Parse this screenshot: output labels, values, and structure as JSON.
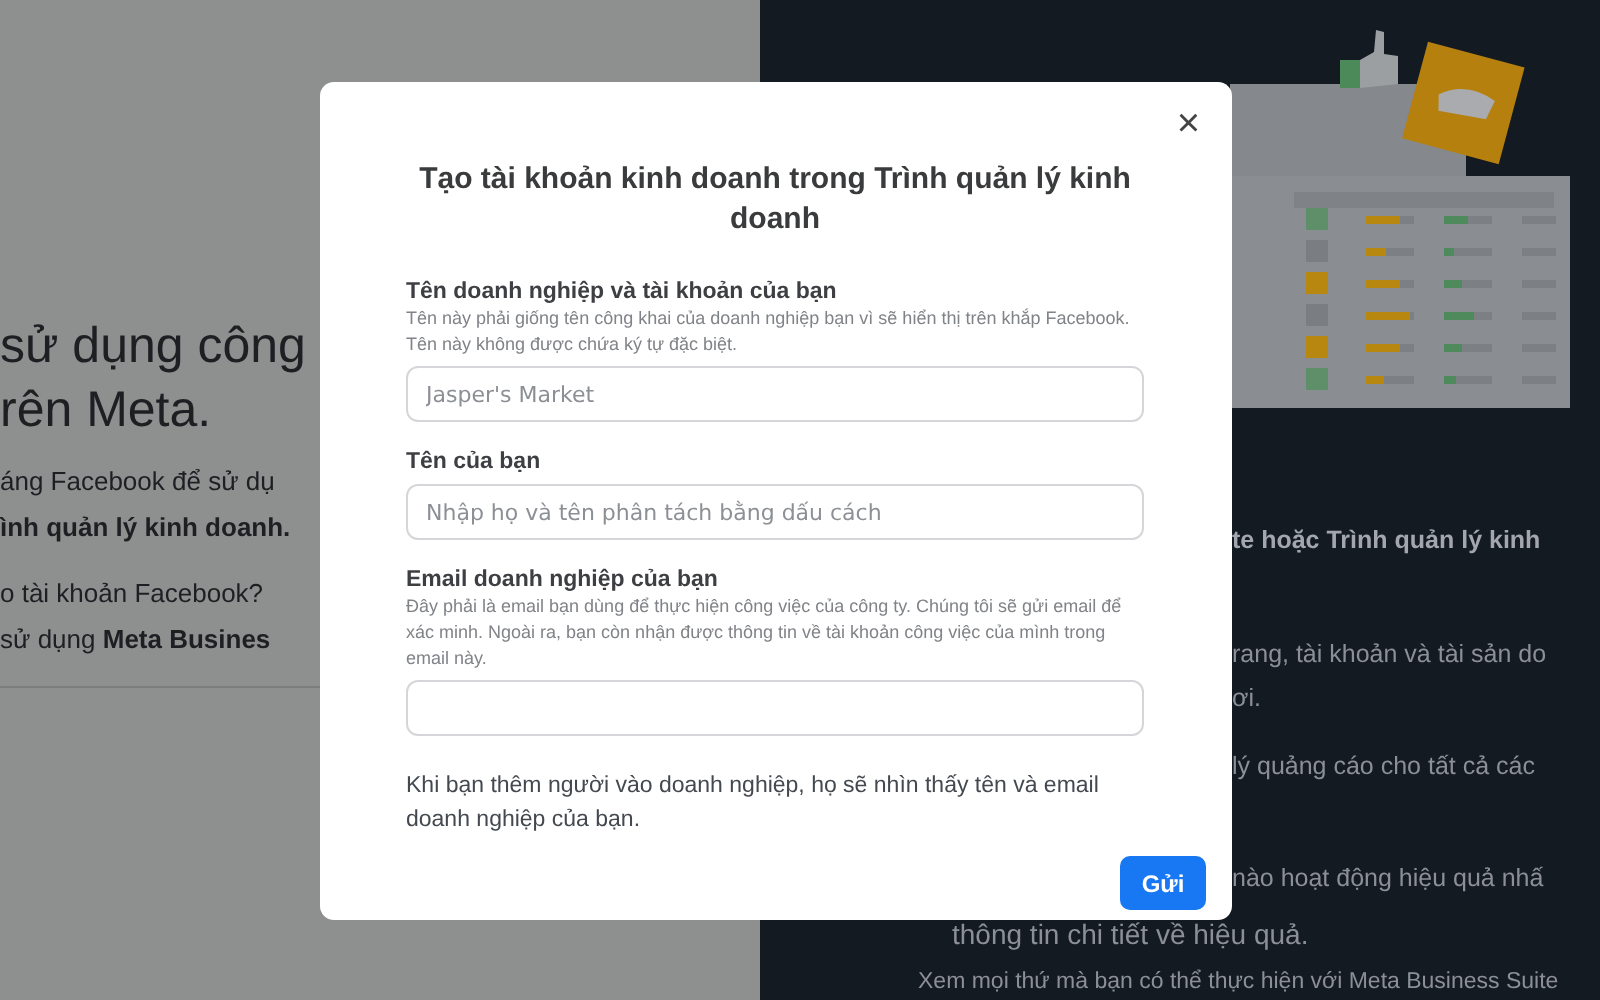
{
  "background": {
    "left": {
      "heading": [
        "sử dụng công",
        "rên Meta."
      ],
      "lines": [
        {
          "text": "áng Facebook để sử dụ",
          "bold": false
        },
        {
          "text": "ình quản lý kinh doanh.",
          "bold": true
        },
        {
          "text": "o tài khoản Facebook?",
          "bold": false
        },
        {
          "text": "sử dụng **Meta Busines**",
          "bold": false
        }
      ]
    },
    "right": {
      "lines": [
        {
          "text": "te hoặc Trình quản lý kinh",
          "bold": true
        },
        {
          "text": "rang, tài khoản và tài sản do",
          "bold": false
        },
        {
          "text": "ơi.",
          "bold": false
        },
        {
          "text": "lý quảng cáo cho tất cả các",
          "bold": false
        },
        {
          "text": "nào hoạt động hiệu quả nhấ",
          "bold": false
        },
        {
          "text": "thông tin chi tiết về hiệu quả.",
          "bold": false
        },
        {
          "text": "Xem mọi thứ mà bạn có thể thực hiện với Meta Business Suite",
          "bold": false
        }
      ]
    }
  },
  "modal": {
    "title": "Tạo tài khoản kinh doanh trong Trình quản lý kinh doanh",
    "close": "×",
    "fields": [
      {
        "label": "Tên doanh nghiệp và tài khoản của bạn",
        "help": "Tên này phải giống tên công khai của doanh nghiệp bạn vì sẽ hiển thị trên khắp Facebook. Tên này không được chứa ký tự đặc biệt.",
        "placeholder": "Jasper's Market"
      },
      {
        "label": "Tên của bạn",
        "placeholder": "Nhập họ và tên phân tách bằng dấu cách"
      },
      {
        "label": "Email doanh nghiệp của bạn",
        "help": "Đây phải là email bạn dùng để thực hiện công việc của công ty. Chúng tôi sẽ gửi email để xác minh. Ngoài ra, bạn còn nhận được thông tin về tài khoản công việc của mình trong email này."
      }
    ],
    "note": "Khi bạn thêm người vào doanh nghiệp, họ sẽ nhìn thấy tên và email doanh nghiệp của bạn.",
    "submit": "Gửi"
  }
}
